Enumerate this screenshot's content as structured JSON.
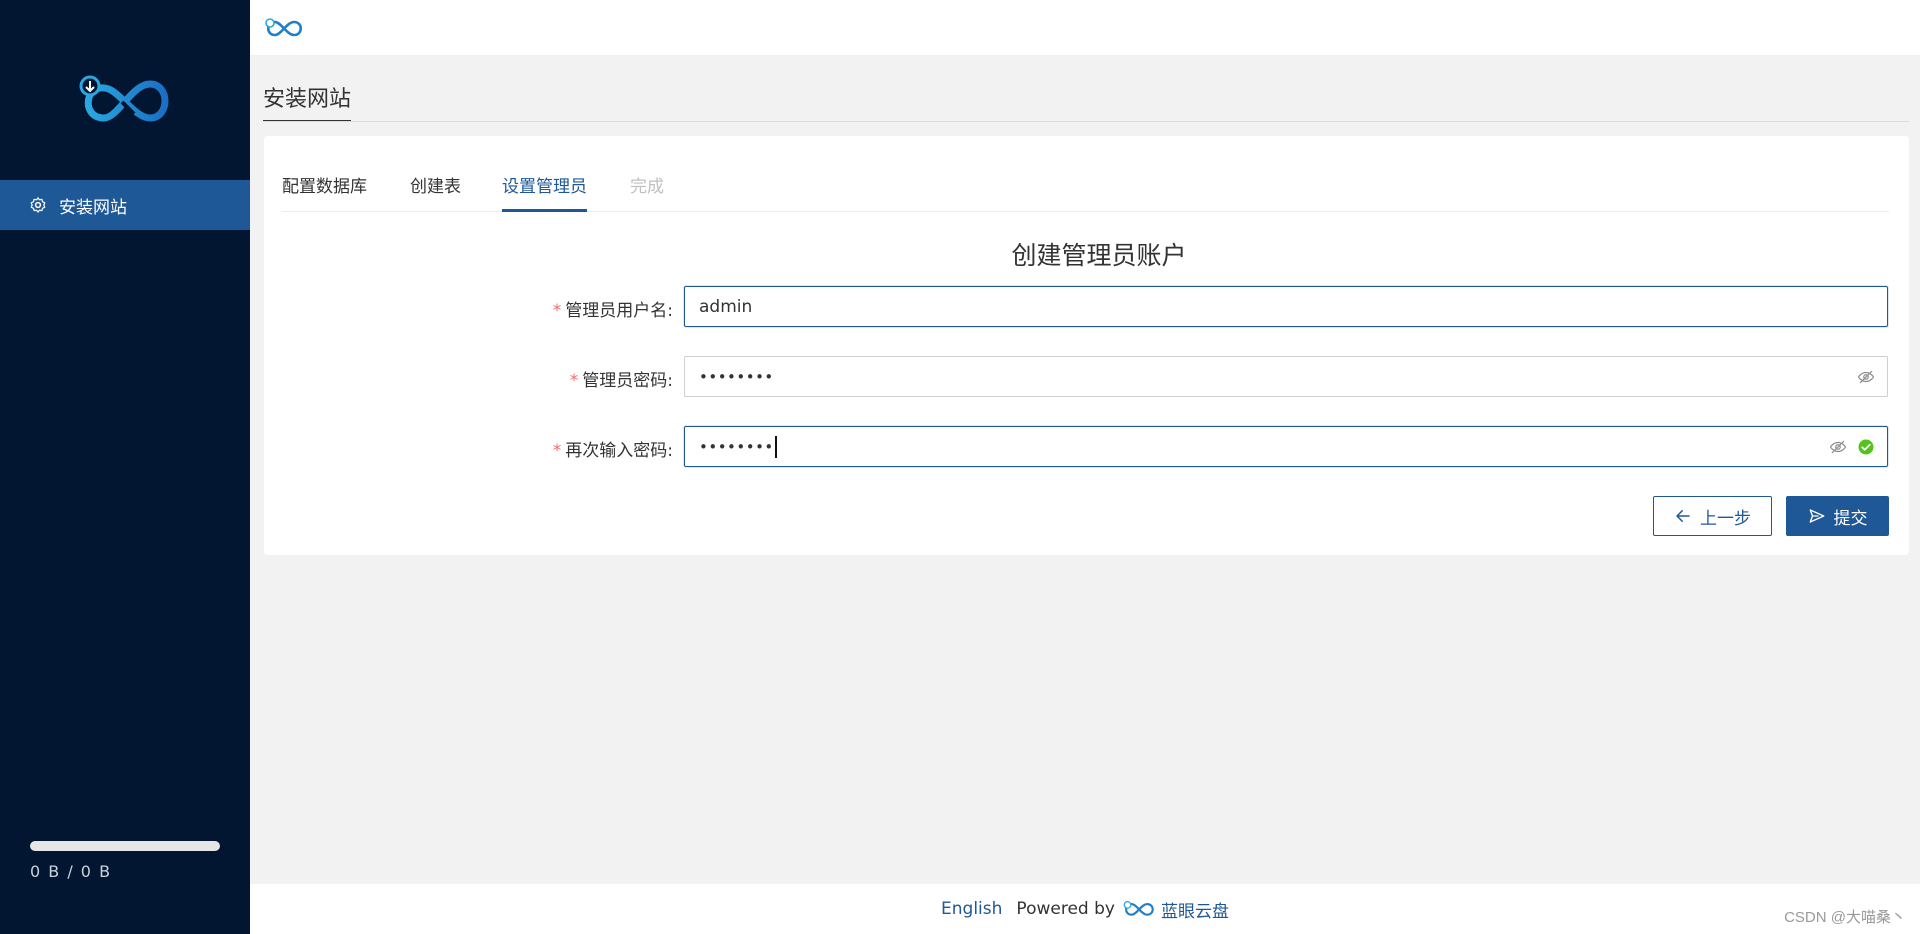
{
  "sidebar": {
    "logo_icon": "brand-infinity-cloud-logo",
    "nav_items": [
      {
        "label": "安装网站",
        "icon": "gear-icon",
        "active": true
      }
    ],
    "storage": {
      "text": "0 B / 0 B",
      "used_fraction": 0
    }
  },
  "header": {
    "logo_icon": "brand-infinity-logo"
  },
  "page": {
    "title": "安装网站"
  },
  "steps": [
    {
      "label": "配置数据库",
      "state": "done"
    },
    {
      "label": "创建表",
      "state": "done"
    },
    {
      "label": "设置管理员",
      "state": "active"
    },
    {
      "label": "完成",
      "state": "disabled"
    }
  ],
  "form": {
    "title": "创建管理员账户",
    "required_mark": "*",
    "fields": {
      "username": {
        "label": "管理员用户名:",
        "value": "admin"
      },
      "password": {
        "label": "管理员密码:",
        "value": "••••••••",
        "icon": "eye-off-icon"
      },
      "confirm": {
        "label": "再次输入密码:",
        "value": "••••••••",
        "icon": "eye-off-icon",
        "status_icon": "check-circle-icon"
      }
    },
    "buttons": {
      "prev": {
        "label": "上一步",
        "icon": "arrow-left-icon"
      },
      "submit": {
        "label": "提交",
        "icon": "send-icon"
      }
    }
  },
  "footer": {
    "language": "English",
    "powered_by": "Powered by",
    "brand": "蓝眼云盘",
    "watermark": "CSDN @大喵桑丶"
  },
  "colors": {
    "sidebar_bg": "#031631",
    "primary": "#1f5896",
    "success": "#52c41a",
    "required": "#f56c6c"
  }
}
